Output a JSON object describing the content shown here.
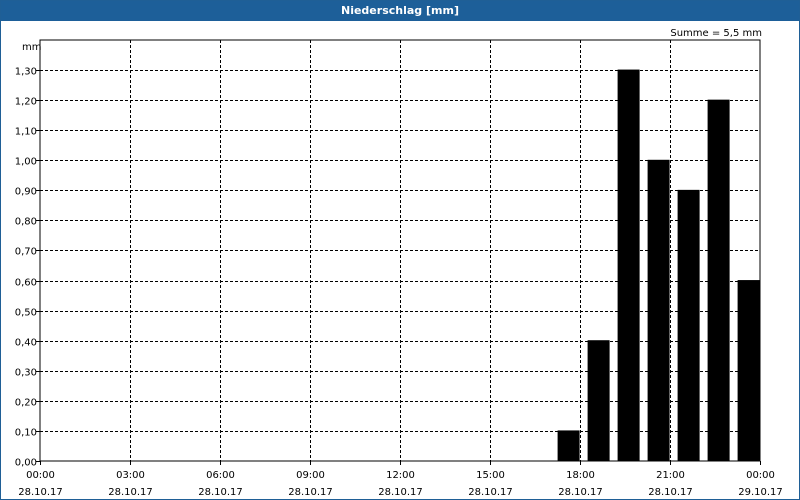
{
  "title": "Niederschlag [mm]",
  "sum_label": "Summe = 5,5 mm",
  "chart_data": {
    "type": "bar",
    "title": "Niederschlag [mm]",
    "ylabel": "mm",
    "ylim": [
      0,
      1.4
    ],
    "yticks": [
      "0,00",
      "0,10",
      "0,20",
      "0,30",
      "0,40",
      "0,50",
      "0,60",
      "0,70",
      "0,80",
      "0,90",
      "1,00",
      "1,10",
      "1,20",
      "1,30"
    ],
    "xlim_hours": [
      0,
      24
    ],
    "xticks": [
      {
        "time": "00:00",
        "date": "28.10.17",
        "hour": 0
      },
      {
        "time": "03:00",
        "date": "28.10.17",
        "hour": 3
      },
      {
        "time": "06:00",
        "date": "28.10.17",
        "hour": 6
      },
      {
        "time": "09:00",
        "date": "28.10.17",
        "hour": 9
      },
      {
        "time": "12:00",
        "date": "28.10.17",
        "hour": 12
      },
      {
        "time": "15:00",
        "date": "28.10.17",
        "hour": 15
      },
      {
        "time": "18:00",
        "date": "28.10.17",
        "hour": 18
      },
      {
        "time": "21:00",
        "date": "28.10.17",
        "hour": 21
      },
      {
        "time": "00:00",
        "date": "29.10.17",
        "hour": 24
      }
    ],
    "bars": [
      {
        "hour_start": 17,
        "hour_end": 18,
        "value": 0.1
      },
      {
        "hour_start": 18,
        "hour_end": 19,
        "value": 0.4
      },
      {
        "hour_start": 19,
        "hour_end": 20,
        "value": 1.3
      },
      {
        "hour_start": 20,
        "hour_end": 21,
        "value": 1.0
      },
      {
        "hour_start": 21,
        "hour_end": 22,
        "value": 0.9
      },
      {
        "hour_start": 22,
        "hour_end": 23,
        "value": 1.2
      },
      {
        "hour_start": 23,
        "hour_end": 24,
        "value": 0.6
      }
    ],
    "grid": true,
    "bar_color": "#000000"
  }
}
